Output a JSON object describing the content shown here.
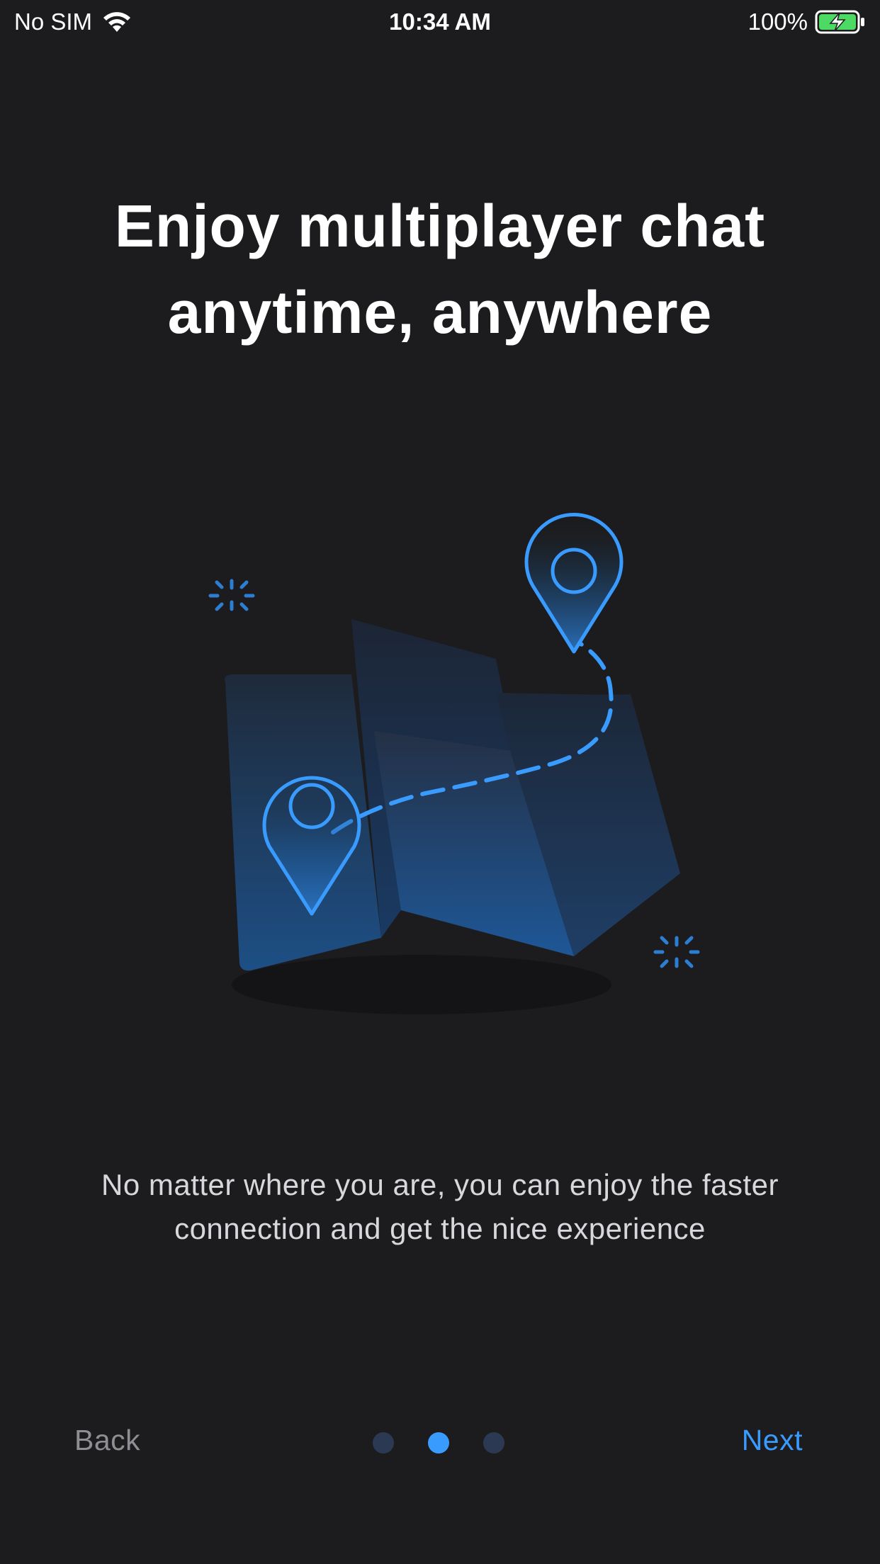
{
  "status_bar": {
    "carrier": "No SIM",
    "time": "10:34 AM",
    "battery": "100%",
    "icons": [
      "wifi-icon",
      "battery-charging-icon"
    ]
  },
  "onboarding": {
    "title_line1": "Enjoy multiplayer chat",
    "title_line2": "anytime, anywhere",
    "description_line1": "No matter where you are, you can enjoy the faster",
    "description_line2": "connection and get the nice experience",
    "illustration": "map-location-pins-icon"
  },
  "navigation": {
    "back_label": "Back",
    "next_label": "Next",
    "page_count": 3,
    "current_page": 2
  },
  "colors": {
    "background": "#1c1c1e",
    "accent": "#3a9bff",
    "muted": "#8e8e93",
    "battery_green": "#4cd964"
  }
}
